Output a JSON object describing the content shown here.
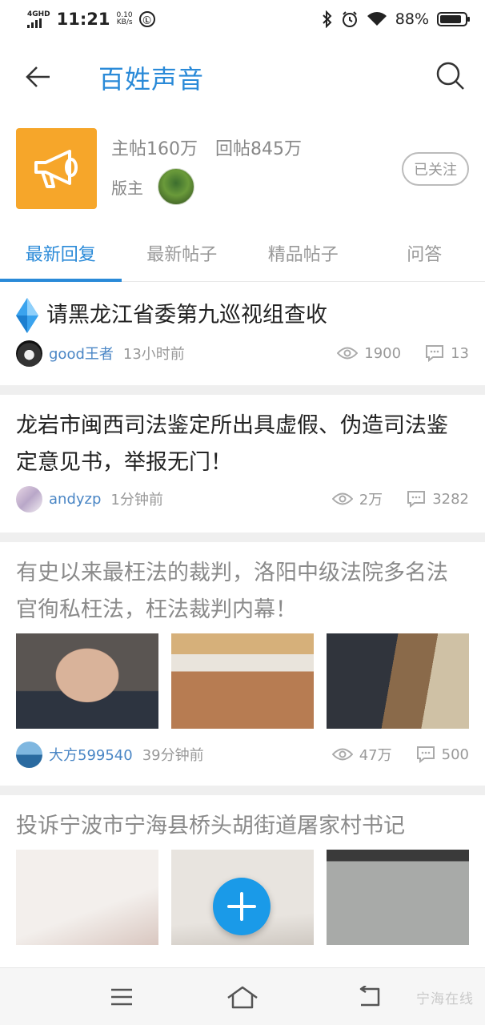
{
  "status_bar": {
    "network": "4GHD",
    "time": "11:21",
    "net_speed_value": "0.10",
    "net_speed_unit": "KB/s",
    "battery": "88%",
    "battery_level": 0.88,
    "icons": [
      "bluetooth-icon",
      "alarm-icon",
      "wifi-icon",
      "battery-icon"
    ]
  },
  "header": {
    "title": "百姓声音"
  },
  "forum": {
    "main_posts": "主帖160万",
    "replies": "回帖845万",
    "moderator_label": "版主",
    "follow_label": "已关注",
    "logo_color": "#f6a62a"
  },
  "tabs": [
    {
      "label": "最新回复",
      "active": true
    },
    {
      "label": "最新帖子",
      "active": false
    },
    {
      "label": "精品帖子",
      "active": false
    },
    {
      "label": "问答",
      "active": false
    }
  ],
  "posts": [
    {
      "title": "请黑龙江省委第九巡视组查收",
      "author": "good王者",
      "time": "13小时前",
      "views": "1900",
      "comments": "13",
      "read": false
    },
    {
      "title": "龙岩市闽西司法鉴定所出具虚假、伪造司法鉴定意见书，举报无门！",
      "author": "andyzp",
      "time": "1分钟前",
      "views": "2万",
      "comments": "3282",
      "read": false
    },
    {
      "title": "有史以来最枉法的裁判，洛阳中级法院多名法官徇私枉法，枉法裁判内幕！",
      "author": "大方599540",
      "time": "39分钟前",
      "views": "47万",
      "comments": "500",
      "read": true
    },
    {
      "title": "投诉宁波市宁海县桥头胡街道屠家村书记",
      "read": true
    }
  ],
  "watermark": "宁海在线",
  "accent_color": "#2a8ad8"
}
